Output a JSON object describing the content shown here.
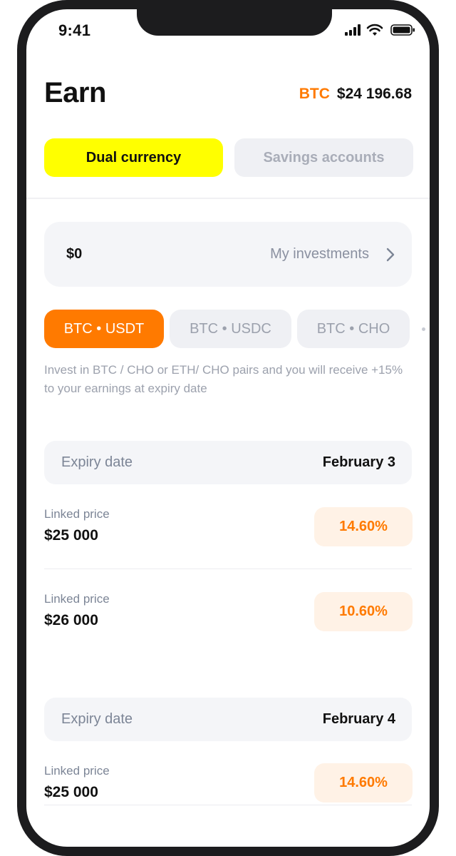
{
  "status_bar": {
    "time": "9:41",
    "icons": [
      "cellular-signal-icon",
      "wifi-icon",
      "battery-icon"
    ]
  },
  "header": {
    "title": "Earn",
    "ticker_symbol": "BTC",
    "ticker_price": "$24 196.68"
  },
  "segments": {
    "active_label": "Dual currency",
    "inactive_label": "Savings accounts"
  },
  "investments": {
    "amount": "$0",
    "link_label": "My investments",
    "icon": "chevron-right-icon"
  },
  "pairs": [
    {
      "label": "BTC • USDT",
      "selected": true
    },
    {
      "label": "BTC • USDC",
      "selected": false
    },
    {
      "label": "BTC • CHO",
      "selected": false
    }
  ],
  "promo_text": "Invest in BTC / CHO or ETH/ CHO pairs and you will receive +15% to your earnings at expiry date",
  "groups": [
    {
      "expiry_label": "Expiry date",
      "expiry_date": "February 3",
      "rows": [
        {
          "label": "Linked price",
          "price": "$25 000",
          "rate": "14.60%"
        },
        {
          "label": "Linked price",
          "price": "$26 000",
          "rate": "10.60%"
        }
      ]
    },
    {
      "expiry_label": "Expiry date",
      "expiry_date": "February 4",
      "rows": [
        {
          "label": "Linked price",
          "price": "$25 000",
          "rate": "14.60%"
        }
      ]
    }
  ],
  "colors": {
    "accent_orange": "#ff7a00",
    "segment_yellow": "#ffff00",
    "rate_background": "#fff2e6",
    "card_background": "#f4f5f8"
  }
}
